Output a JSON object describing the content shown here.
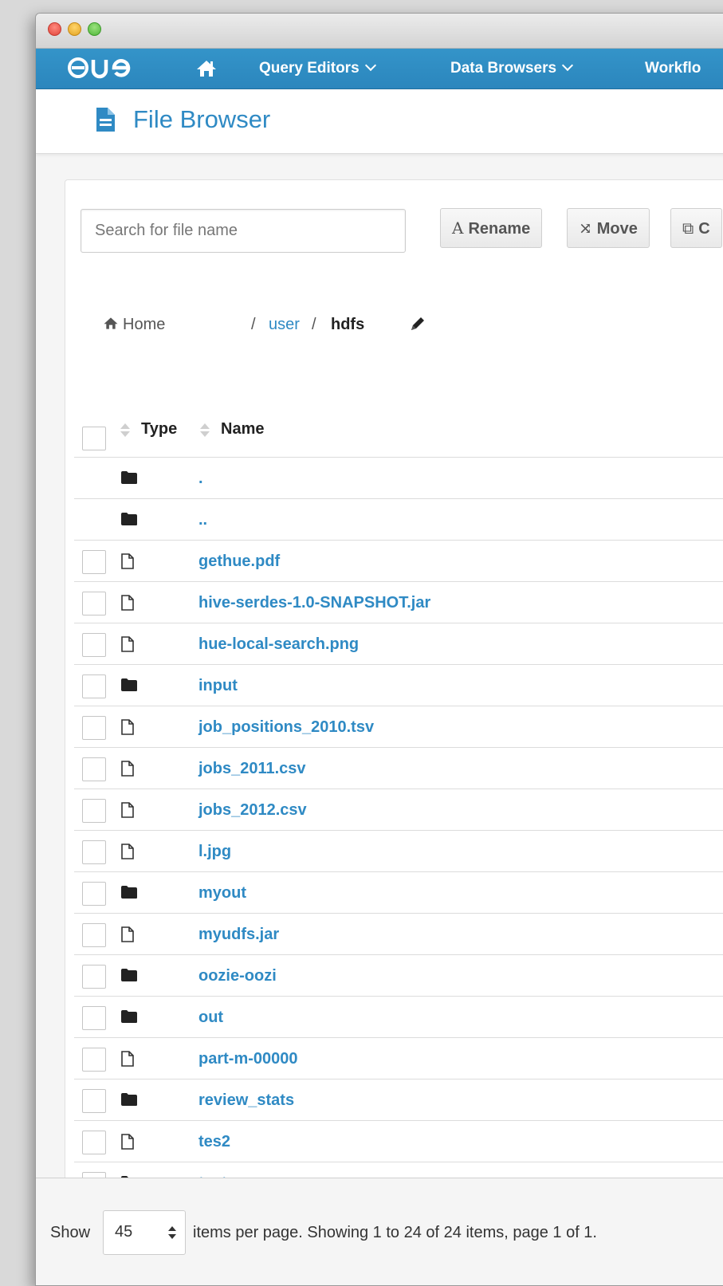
{
  "navbar": {
    "logo": "HUE",
    "items": [
      {
        "label": "Query Editors"
      },
      {
        "label": "Data Browsers"
      },
      {
        "label": "Workflo"
      }
    ]
  },
  "header": {
    "title": "File Browser"
  },
  "toolbar": {
    "search_placeholder": "Search for file name",
    "rename_label": "Rename",
    "move_label": "Move",
    "copy_label": "C"
  },
  "breadcrumb": {
    "home": "Home",
    "sep1": "/",
    "user": "user",
    "sep2": "/",
    "current": "hdfs"
  },
  "table": {
    "columns": {
      "type": "Type",
      "name": "Name"
    },
    "rows": [
      {
        "type": "folder",
        "name": ".",
        "selectable": false
      },
      {
        "type": "folder",
        "name": "..",
        "selectable": false
      },
      {
        "type": "file",
        "name": "gethue.pdf",
        "selectable": true
      },
      {
        "type": "file",
        "name": "hive-serdes-1.0-SNAPSHOT.jar",
        "selectable": true
      },
      {
        "type": "file",
        "name": "hue-local-search.png",
        "selectable": true
      },
      {
        "type": "folder",
        "name": "input",
        "selectable": true
      },
      {
        "type": "file",
        "name": "job_positions_2010.tsv",
        "selectable": true
      },
      {
        "type": "file",
        "name": "jobs_2011.csv",
        "selectable": true
      },
      {
        "type": "file",
        "name": "jobs_2012.csv",
        "selectable": true
      },
      {
        "type": "file",
        "name": "l.jpg",
        "selectable": true
      },
      {
        "type": "folder",
        "name": "myout",
        "selectable": true
      },
      {
        "type": "file",
        "name": "myudfs.jar",
        "selectable": true
      },
      {
        "type": "folder",
        "name": "oozie-oozi",
        "selectable": true
      },
      {
        "type": "folder",
        "name": "out",
        "selectable": true
      },
      {
        "type": "file",
        "name": "part-m-00000",
        "selectable": true
      },
      {
        "type": "folder",
        "name": "review_stats",
        "selectable": true
      },
      {
        "type": "file",
        "name": "tes2",
        "selectable": true
      },
      {
        "type": "folder",
        "name": "test_sqoop",
        "selectable": true
      }
    ]
  },
  "footer": {
    "show_label": "Show",
    "per_page": "45",
    "summary": "items per page. Showing 1 to 24 of 24 items, page 1 of 1."
  },
  "colors": {
    "navbar": "#2b86bd",
    "link": "#2f8ac4"
  }
}
